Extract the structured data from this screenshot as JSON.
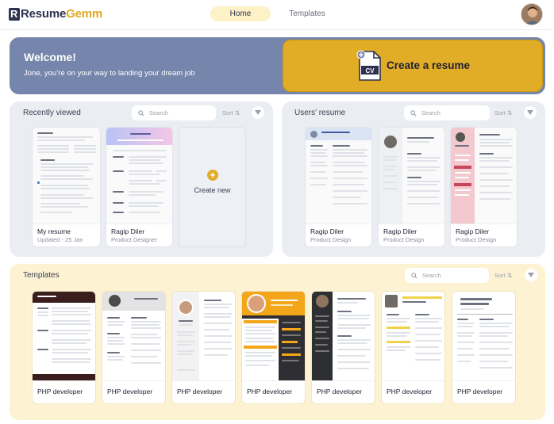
{
  "app": {
    "logo_part1": "Resume",
    "logo_part2": "Gemm"
  },
  "nav": {
    "home": "Home",
    "templates": "Templates"
  },
  "welcome": {
    "title": "Welcome!",
    "subtitle": "Jone, you’re on your way to landing your dream job",
    "cta": "Create a resume",
    "cta_icon_text": "CV"
  },
  "recent": {
    "title": "Recently viewed",
    "search_placeholder": "Search",
    "sort": "Sort",
    "cards": [
      {
        "title": "My resume",
        "sub": "Updated - 25 Jan"
      },
      {
        "title": "Ragip Diler",
        "sub": "Product Designer"
      }
    ],
    "create_new": "Create new"
  },
  "users": {
    "title": "Users' resume",
    "search_placeholder": "Search",
    "sort": "Sort",
    "cards": [
      {
        "title": "Ragip Diler",
        "sub": "Product Design"
      },
      {
        "title": "Ragip Diler",
        "sub": "Product Design"
      },
      {
        "title": "Ragip Diler",
        "sub": "Product Design"
      }
    ]
  },
  "templates": {
    "title": "Templates",
    "search_placeholder": "Search",
    "sort": "Sort",
    "cards": [
      {
        "title": "PHP developer"
      },
      {
        "title": "PHP developer"
      },
      {
        "title": "PHP developer"
      },
      {
        "title": "PHP developer"
      },
      {
        "title": "PHP developer"
      },
      {
        "title": "PHP developer"
      },
      {
        "title": "PHP developer"
      }
    ]
  },
  "colors": {
    "brand_dark": "#2d3250",
    "brand_accent": "#e0a81f",
    "banner": "#7585ab",
    "panel_grey": "#eaedf2",
    "panel_yellow": "#fdf3d3"
  }
}
